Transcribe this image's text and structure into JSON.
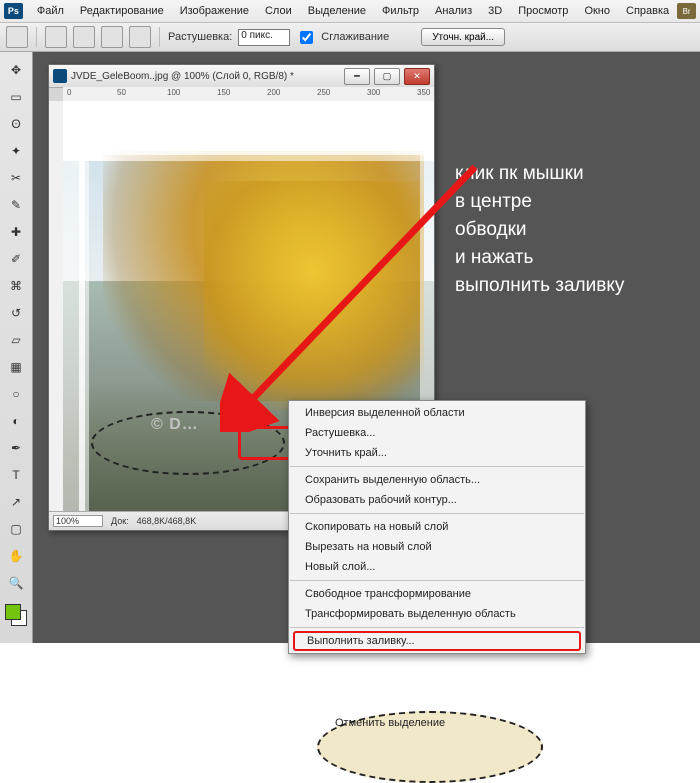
{
  "menubar": {
    "ps_logo": "Ps",
    "items": [
      "Файл",
      "Редактирование",
      "Изображение",
      "Слои",
      "Выделение",
      "Фильтр",
      "Анализ",
      "3D",
      "Просмотр",
      "Окно",
      "Справка"
    ],
    "bridge": "Br"
  },
  "options": {
    "feather_label": "Растушевка:",
    "feather_value": "0 пикс.",
    "antialias_label": "Сглаживание",
    "refine_btn": "Уточн. край..."
  },
  "tools": {
    "items": [
      "move",
      "marquee",
      "lasso",
      "wand",
      "crop",
      "eyedropper",
      "heal",
      "brush",
      "stamp",
      "history",
      "eraser",
      "gradient",
      "blur",
      "dodge",
      "pen",
      "type",
      "path",
      "rect",
      "hand",
      "zoom"
    ],
    "fg_color": "#74c40e",
    "bg_color": "#ffffff"
  },
  "window": {
    "title": "JVDE_GeleBoom..jpg @ 100% (Слой 0, RGB/8) *",
    "ruler_marks": [
      "0",
      "50",
      "100",
      "150",
      "200",
      "250",
      "300",
      "350"
    ],
    "watermark": "© D…",
    "zoom": "100%",
    "doc_size_label": "Док:",
    "doc_size": "468,8K/468,8K"
  },
  "context_menu": {
    "items": [
      {
        "label": "Отменить выделение",
        "sel": true
      },
      {
        "label": "Инверсия выделенной области"
      },
      {
        "label": "Растушевка..."
      },
      {
        "label": "Уточнить край..."
      },
      {
        "sep": true
      },
      {
        "label": "Сохранить выделенную область..."
      },
      {
        "label": "Образовать рабочий контур..."
      },
      {
        "sep": true
      },
      {
        "label": "Скопировать на новый слой"
      },
      {
        "label": "Вырезать на новый слой"
      },
      {
        "label": "Новый слой..."
      },
      {
        "sep": true
      },
      {
        "label": "Свободное трансформирование"
      },
      {
        "label": "Трансформировать выделенную область"
      },
      {
        "sep": true
      },
      {
        "label": "Выполнить заливку...",
        "hl": true
      }
    ]
  },
  "annotation": {
    "line1": "клик пк мышки",
    "line2": "в центре",
    "line3": "обводки",
    "line4": "и нажать",
    "line5": "выполнить заливку"
  },
  "colors": {
    "arrow": "#e81717"
  }
}
